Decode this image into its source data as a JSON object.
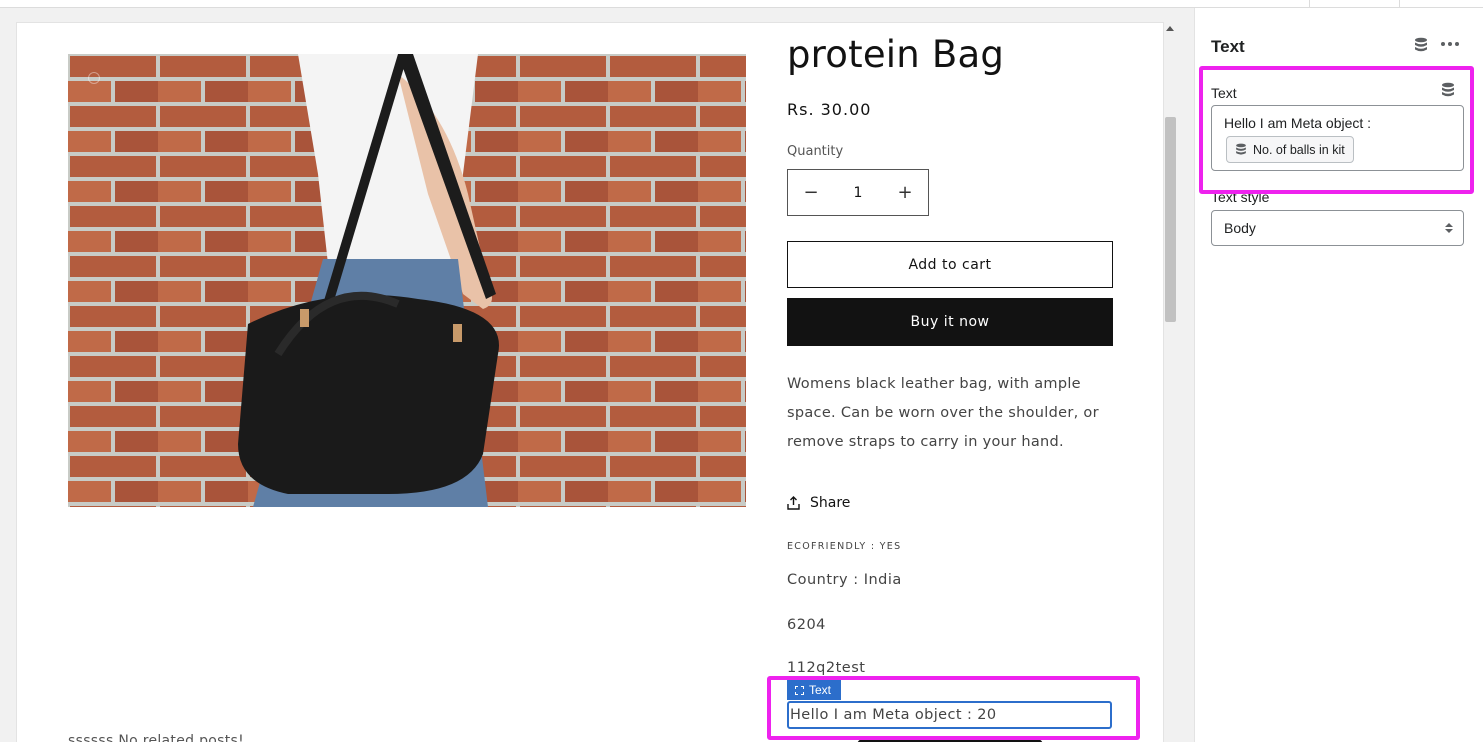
{
  "preview": {
    "product": {
      "title": "protein Bag",
      "price": "Rs. 30.00",
      "quantity_label": "Quantity",
      "quantity_value": "1",
      "decrement_symbol": "−",
      "increment_symbol": "+",
      "add_to_cart_label": "Add to cart",
      "buy_now_label": "Buy it now",
      "description": "Womens black leather bag, with ample space. Can be worn over the shoulder, or remove straps to carry in your hand.",
      "share_label": "Share",
      "ecofriendly": "ECOFRIENDLY : YES",
      "country": "Country : India",
      "meta_value_1": "6204",
      "meta_value_2": "112q2test",
      "selected_block_tag": "Text",
      "selected_block_text": "Hello I am Meta object : 20"
    },
    "related_posts": "ssssss No related posts!"
  },
  "panel": {
    "title": "Text",
    "text_field": {
      "label": "Text",
      "value": "Hello I am Meta object :",
      "dynamic_source_pill": "No. of balls in kit"
    },
    "text_style": {
      "label": "Text style",
      "selected": "Body"
    }
  },
  "colors": {
    "highlight": "#ee22ee",
    "selection_blue": "#2c6ecb",
    "button_dark": "#121212"
  },
  "icons": {
    "panel_header": "database-icon",
    "panel_menu": "more-horizontal-icon",
    "share": "share-icon",
    "pill": "database-icon",
    "select": "select-arrows-icon"
  }
}
